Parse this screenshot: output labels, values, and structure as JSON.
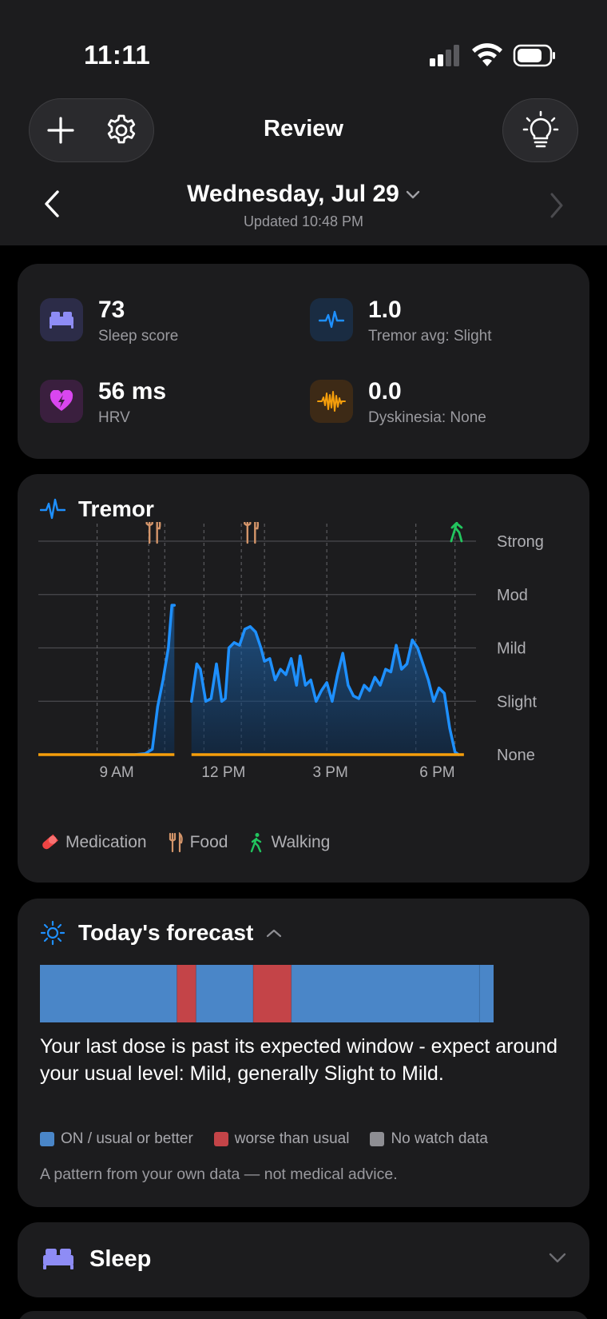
{
  "status": {
    "time": "11:11"
  },
  "nav": {
    "title": "Review"
  },
  "date": {
    "title": "Wednesday, Jul 29",
    "updated": "Updated 10:48 PM"
  },
  "metrics": [
    {
      "value": "73",
      "label": "Sleep score",
      "icon": "bed-icon",
      "color": "#8e8cf5"
    },
    {
      "value": "1.0",
      "label": "Tremor avg: Slight",
      "icon": "tremor-wave-icon",
      "color": "#1e90ff"
    },
    {
      "value": "56 ms",
      "label": "HRV",
      "icon": "heart-bolt-icon",
      "color": "#d946ef"
    },
    {
      "value": "0.0",
      "label": "Dyskinesia: None",
      "icon": "dyskinesia-wave-icon",
      "color": "#f59e0b"
    }
  ],
  "tremor": {
    "title": "Tremor",
    "legend": {
      "medication": "Medication",
      "food": "Food",
      "walking": "Walking"
    }
  },
  "chart_data": {
    "type": "area",
    "title": "Tremor",
    "y_levels": [
      "None",
      "Slight",
      "Mild",
      "Mod",
      "Strong"
    ],
    "ylim": [
      0,
      4
    ],
    "x_tick_labels": [
      "9 AM",
      "12 PM",
      "3 PM",
      "6 PM"
    ],
    "x_tick_hours": [
      9,
      12,
      15,
      18
    ],
    "xlim": [
      6.8,
      19.0
    ],
    "series": [
      {
        "segments": [
          {
            "x": [
              9.1,
              9.5,
              9.8,
              10.0,
              10.15,
              10.3,
              10.45,
              10.55,
              10.62
            ],
            "y": [
              0.0,
              0.0,
              0.02,
              0.1,
              0.9,
              1.4,
              2.0,
              2.8,
              2.8
            ]
          },
          {
            "x": [
              11.1,
              11.25,
              11.35,
              11.5,
              11.65,
              11.8,
              11.95,
              12.05,
              12.15,
              12.3,
              12.45,
              12.6,
              12.75,
              12.9,
              13.05,
              13.15,
              13.3,
              13.45,
              13.6,
              13.75,
              13.9,
              14.05,
              14.15,
              14.3,
              14.45,
              14.6,
              14.75,
              14.9,
              15.05,
              15.2,
              15.35,
              15.5,
              15.65,
              15.8,
              15.95,
              16.1,
              16.25,
              16.4,
              16.55,
              16.7,
              16.85,
              17.0,
              17.15,
              17.3,
              17.45,
              17.6,
              17.75,
              17.9,
              18.05,
              18.2,
              18.35,
              18.5,
              18.6
            ],
            "y": [
              1.0,
              1.7,
              1.6,
              1.0,
              1.05,
              1.7,
              1.0,
              1.05,
              2.0,
              2.1,
              2.05,
              2.35,
              2.4,
              2.3,
              2.0,
              1.75,
              1.8,
              1.4,
              1.6,
              1.5,
              1.8,
              1.3,
              1.85,
              1.3,
              1.4,
              1.0,
              1.2,
              1.35,
              1.0,
              1.5,
              1.9,
              1.3,
              1.1,
              1.05,
              1.3,
              1.2,
              1.45,
              1.3,
              1.6,
              1.55,
              2.05,
              1.6,
              1.7,
              2.15,
              2.0,
              1.7,
              1.4,
              1.0,
              1.25,
              1.15,
              0.5,
              0.05,
              0.0
            ]
          }
        ],
        "color": "#1e90ff"
      }
    ],
    "dyskinesia_baseline": {
      "color": "#f59e0b",
      "segments": [
        [
          6.8,
          10.62
        ],
        [
          11.1,
          18.75
        ]
      ]
    },
    "event_lines_hours": [
      8.45,
      9.9,
      10.35,
      11.45,
      12.5,
      13.15,
      14.9,
      17.4,
      18.5
    ],
    "events": [
      {
        "type": "food",
        "hour": 10.0
      },
      {
        "type": "food",
        "hour": 12.75
      },
      {
        "type": "walking",
        "hour": 18.55
      }
    ]
  },
  "forecast": {
    "title": "Today's forecast",
    "segments": [
      {
        "state": "on",
        "frac": 0.302
      },
      {
        "state": "worse",
        "frac": 0.042
      },
      {
        "state": "on",
        "frac": 0.126
      },
      {
        "state": "worse",
        "frac": 0.084
      },
      {
        "state": "on",
        "frac": 0.415
      },
      {
        "state": "on",
        "frac": 0.031
      }
    ],
    "colors": {
      "on": "#4a86c8",
      "worse": "#c44448",
      "no_data": "#8e8e93"
    },
    "message": "Your last dose is past its expected window - expect around your usual level: Mild, generally Slight to Mild.",
    "legend": {
      "on": "ON / usual or better",
      "worse": "worse than usual",
      "no_data": "No watch data"
    },
    "disclaimer": "A pattern from your own data — not medical advice."
  },
  "sleep": {
    "title": "Sleep"
  }
}
